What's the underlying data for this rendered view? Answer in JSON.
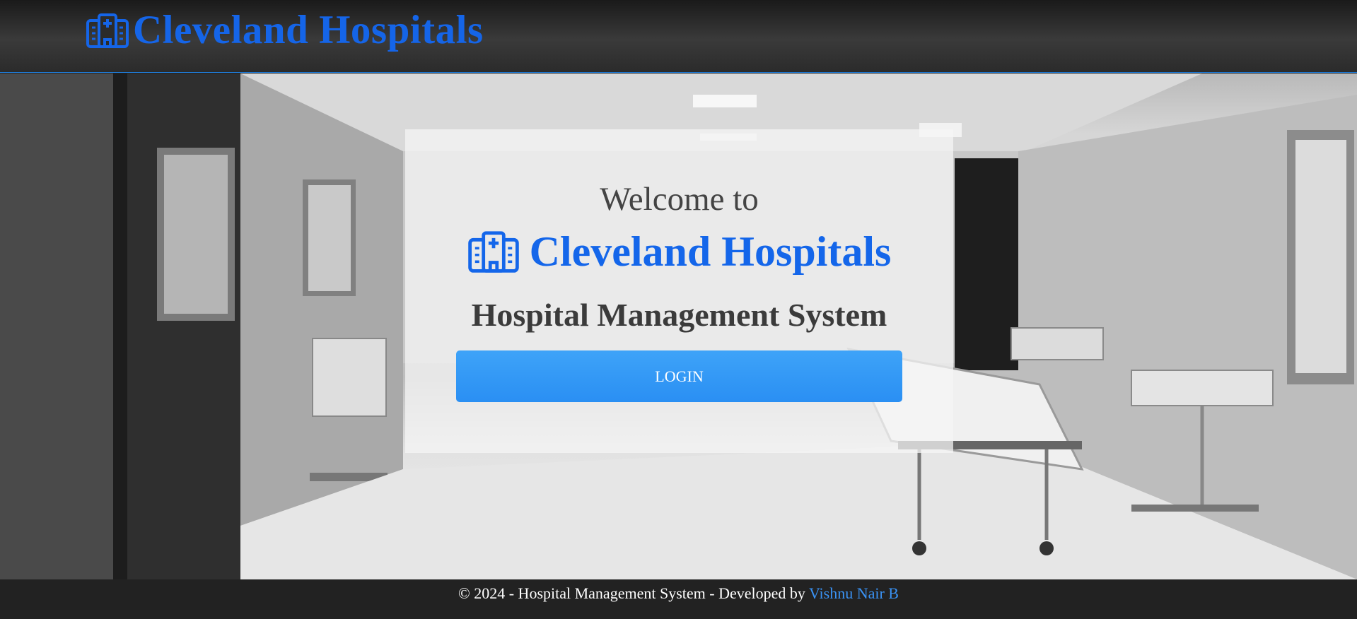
{
  "header": {
    "brand_text": "Cleveland Hospitals",
    "brand_icon": "hospital-icon"
  },
  "hero": {
    "background": "grayscale hospital ward photo"
  },
  "panel": {
    "welcome": "Welcome to",
    "brand_text": "Cleveland Hospitals",
    "brand_icon": "hospital-icon",
    "subtitle": "Hospital Management System",
    "login_label": "LOGIN"
  },
  "footer": {
    "text": "© 2024 - Hospital Management System - Developed by ",
    "link_text": "Vishnu Nair B"
  },
  "colors": {
    "brand": "#1565e8",
    "button": "#2e93f5",
    "header_bg": "#2b2b2b",
    "footer_bg": "#222222",
    "link": "#3a93f5"
  }
}
